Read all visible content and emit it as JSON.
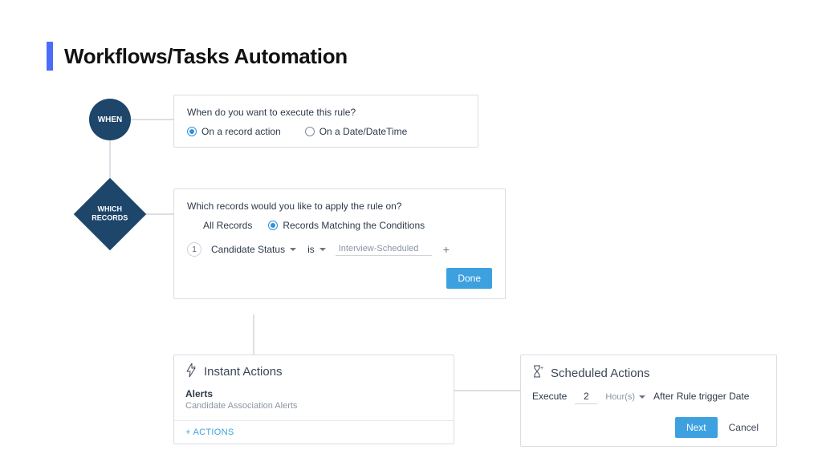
{
  "heading": "Workflows/Tasks Automation",
  "colors": {
    "accent_bar": "#4a6cf7",
    "node_fill": "#1e466b",
    "primary_btn": "#3da1e0"
  },
  "flow": {
    "when_node": "WHEN",
    "which_node": "WHICH\nRECORDS"
  },
  "when_card": {
    "question": "When do you want to execute this rule?",
    "option_record": "On a record action",
    "option_date": "On a Date/DateTime",
    "selected": "record"
  },
  "which_card": {
    "question": "Which records would you like to apply the rule on?",
    "option_all": "All Records",
    "option_match": "Records Matching the Conditions",
    "selected": "match",
    "condition": {
      "index": "1",
      "field": "Candidate Status",
      "operator": "is",
      "value": "Interview-Scheduled"
    },
    "done_label": "Done"
  },
  "instant_card": {
    "title": "Instant Actions",
    "section": "Alerts",
    "item": "Candidate Association Alerts",
    "add_label": "+ ACTIONS"
  },
  "scheduled_card": {
    "title": "Scheduled Actions",
    "execute_label": "Execute",
    "value": "2",
    "unit": "Hour(s)",
    "after_text": "After Rule trigger Date",
    "next_label": "Next",
    "cancel_label": "Cancel"
  }
}
